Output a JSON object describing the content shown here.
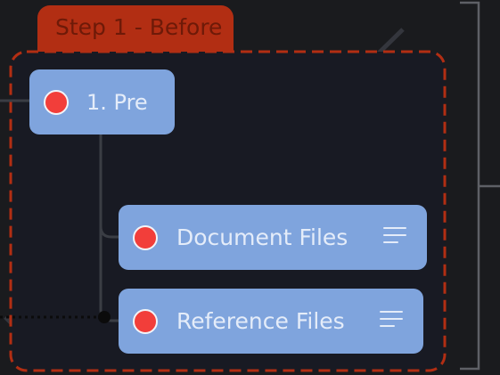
{
  "group": {
    "tab_label": "Step 1 - Before"
  },
  "nodes": [
    {
      "id": "pre",
      "label": "1. Pre",
      "has_menu": false
    },
    {
      "id": "document-files",
      "label": "Document Files",
      "has_menu": true
    },
    {
      "id": "reference-files",
      "label": "Reference Files",
      "has_menu": true
    }
  ],
  "colors": {
    "background": "#1a1b1e",
    "group_fill": "#181a23",
    "group_border": "#b22e13",
    "tab_fill": "#b22e13",
    "tab_text": "#6e1a08",
    "node_fill": "#7fa4dd",
    "node_text": "#e4ecf9",
    "status_dot": "#f23e3a",
    "connector": "#3a3d44",
    "dotted_edge": "#0b0b0b"
  },
  "icons": {
    "status": "red-status-dot",
    "menu": "hamburger-menu-icon",
    "edge_endpoint": "connection-endpoint-dot"
  }
}
